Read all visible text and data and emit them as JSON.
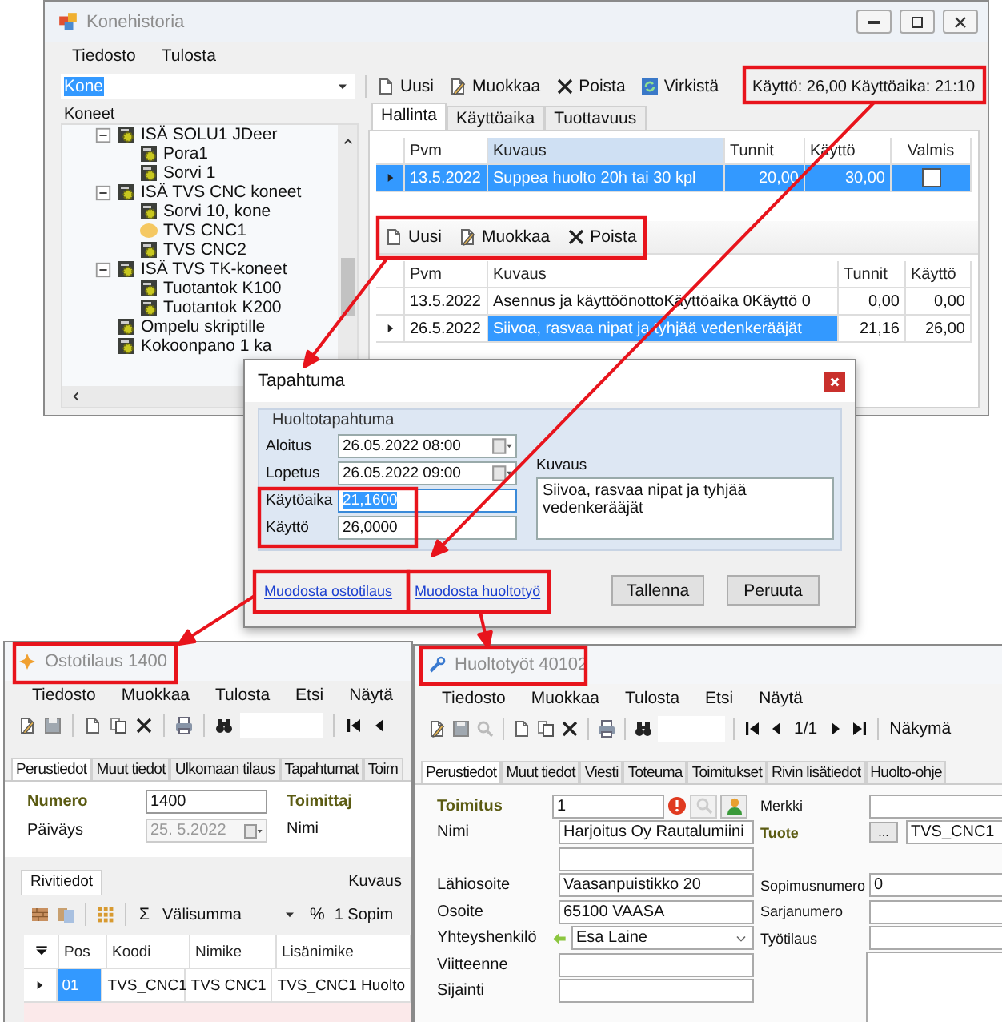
{
  "main_window": {
    "title": "Konehistoria",
    "menu": [
      "Tiedosto",
      "Tulosta"
    ],
    "machine_combo": {
      "value": "Kone"
    },
    "toolbar": [
      "Uusi",
      "Muokkaa",
      "Poista",
      "Virkistä"
    ],
    "status": "Käyttö: 26,00  Käyttöaika: 21:10",
    "tree": {
      "title": "Koneet",
      "items": [
        {
          "label": "ISÄ SOLU1 JDeer",
          "expanded": true,
          "selected": false,
          "children": [
            {
              "label": "Pora1",
              "selected": false
            },
            {
              "label": "Sorvi 1",
              "selected": false
            }
          ]
        },
        {
          "label": "ISÄ TVS CNC koneet",
          "expanded": true,
          "selected": false,
          "children": [
            {
              "label": "Sorvi 10, kone",
              "selected": false
            },
            {
              "label": "TVS CNC1",
              "selected": true
            },
            {
              "label": "TVS CNC2",
              "selected": false
            }
          ]
        },
        {
          "label": "ISÄ TVS TK-koneet",
          "expanded": true,
          "selected": false,
          "children": [
            {
              "label": "Tuotantok K100",
              "selected": false
            },
            {
              "label": "Tuotantok K200",
              "selected": false
            }
          ]
        },
        {
          "label": "Ompelu skriptille",
          "selected": false
        },
        {
          "label": "Kokoonpano 1 ka",
          "selected": false
        }
      ]
    },
    "tabs": [
      {
        "label": "Hallinta",
        "selected": true
      },
      {
        "label": "Käyttöaika",
        "selected": false
      },
      {
        "label": "Tuottavuus",
        "selected": false
      }
    ],
    "plan_table": {
      "columns": [
        "Pvm",
        "Kuvaus",
        "Tunnit",
        "Käyttö",
        "Valmis"
      ],
      "rows": [
        {
          "current": true,
          "selected": true,
          "done": false,
          "cells": [
            "13.5.2022",
            "Suppea huolto 20h tai 30 kpl",
            "20,00",
            "30,00"
          ]
        }
      ]
    },
    "event_toolbar": [
      "Uusi",
      "Muokkaa",
      "Poista"
    ],
    "event_table": {
      "columns": [
        "Pvm",
        "Kuvaus",
        "Tunnit",
        "Käyttö"
      ],
      "rows": [
        {
          "current": false,
          "selected": false,
          "cells": [
            "13.5.2022",
            "Asennus ja käyttöönottoKäyttöaika 0Käyttö 0",
            "0,00",
            "0,00"
          ]
        },
        {
          "current": true,
          "selected": true,
          "cells": [
            "26.5.2022",
            "Siivoa, rasvaa nipat ja tyhjää vedenkerääjät",
            "21,16",
            "26,00"
          ]
        }
      ]
    }
  },
  "dialog": {
    "title": "Tapahtuma",
    "group": "Huoltotapahtuma",
    "fields": [
      {
        "label": "Aloitus",
        "value": "26.05.2022 08:00",
        "kind": "datetime",
        "focused": false
      },
      {
        "label": "Lopetus",
        "value": "26.05.2022 09:00",
        "kind": "datetime",
        "focused": false
      },
      {
        "label": "Käytöaika",
        "value": "21,1600",
        "kind": "text",
        "focused": true
      },
      {
        "label": "Käyttö",
        "value": "26,0000",
        "kind": "text",
        "focused": false
      }
    ],
    "description": {
      "label": "Kuvaus",
      "value": "Siivoa, rasvaa nipat ja tyhjää vedenkerääjät"
    },
    "links": [
      "Muodosta ostotilaus",
      "Muodosta huoltotyö"
    ],
    "buttons": [
      "Tallenna",
      "Peruuta"
    ]
  },
  "purchase_window": {
    "title": "Ostotilaus 1400",
    "menu": [
      "Tiedosto",
      "Muokkaa",
      "Tulosta",
      "Etsi",
      "Näytä"
    ],
    "tabs": [
      {
        "label": "Perustiedot",
        "selected": true
      },
      {
        "label": "Muut tiedot",
        "selected": false
      },
      {
        "label": "Ulkomaan tilaus",
        "selected": false
      },
      {
        "label": "Tapahtumat",
        "selected": false
      },
      {
        "label": "Toim",
        "selected": false
      }
    ],
    "fields": [
      {
        "label": "Numero",
        "value": "1400",
        "required": true,
        "disabled": false
      },
      {
        "label": "Päiväys",
        "value": "25. 5.2022",
        "required": false,
        "disabled": true
      }
    ],
    "supplier": {
      "label": "Toimittaj",
      "name_label": "Nimi"
    },
    "line_tabs": [
      {
        "label": "Rivitiedot",
        "selected": true
      }
    ],
    "description_label": "Kuvaus",
    "line_toolbar": {
      "sum_symbol": "Σ",
      "subtotal": "Välisumma",
      "percent": "%",
      "agreement": "1 Sopim"
    },
    "line_table": {
      "columns": [
        "Pos",
        "Koodi",
        "Nimike",
        "Lisänimike"
      ],
      "rows": [
        {
          "current": true,
          "cells": [
            "01",
            "TVS_CNC1",
            "TVS CNC1",
            "TVS_CNC1 Huolto"
          ]
        }
      ]
    }
  },
  "service_window": {
    "title": "Huoltotyöt 40102",
    "menu": [
      "Tiedosto",
      "Muokkaa",
      "Tulosta",
      "Etsi",
      "Näytä"
    ],
    "record_position": "1/1",
    "view_label": "Näkymä",
    "tabs": [
      {
        "label": "Perustiedot",
        "selected": true
      },
      {
        "label": "Muut tiedot",
        "selected": false
      },
      {
        "label": "Viesti",
        "selected": false
      },
      {
        "label": "Toteuma",
        "selected": false
      },
      {
        "label": "Toimitukset",
        "selected": false
      },
      {
        "label": "Rivin lisätiedot",
        "selected": false
      },
      {
        "label": "Huolto-ohje",
        "selected": false
      }
    ],
    "left_fields": [
      {
        "label": "Toimitus",
        "value": "1",
        "kind": "customer",
        "required": true
      },
      {
        "label": "Nimi",
        "value": "Harjoitus Oy Rautalumiini",
        "kind": "text",
        "required": false
      },
      {
        "kind": "text"
      },
      {
        "label": "Lähiosoite",
        "value": "Vaasanpuistikko 20",
        "kind": "text",
        "required": false
      },
      {
        "label": "Osoite",
        "value": "65100  VAASA",
        "kind": "text",
        "required": false
      },
      {
        "label": "Yhteyshenkilö",
        "value": "Esa Laine",
        "kind": "combo",
        "required": false
      },
      {
        "label": "Viitteenne",
        "kind": "text",
        "required": false
      },
      {
        "label": "Sijainti",
        "kind": "text",
        "required": false
      }
    ],
    "right_fields": [
      {
        "label": "Merkki",
        "kind": "text",
        "required": false
      },
      {
        "label": "Tuote",
        "value": "TVS_CNC1",
        "button": "...",
        "kind": "lookup",
        "required": true
      },
      {
        "kind": "gap"
      },
      {
        "label": "Sopimusnumero",
        "value": "0",
        "kind": "text",
        "required": false
      },
      {
        "label": "Sarjanumero",
        "kind": "text",
        "required": false
      },
      {
        "label": "Työtilaus",
        "kind": "text",
        "required": false
      },
      {
        "kind": "memo"
      }
    ]
  }
}
